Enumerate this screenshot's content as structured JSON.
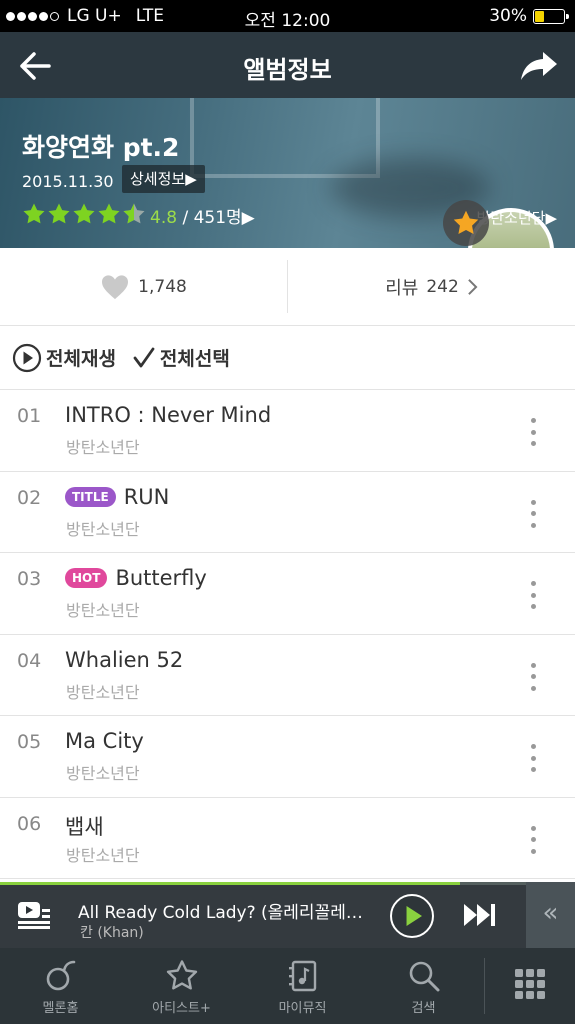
{
  "status_bar": {
    "carrier": "LG U+",
    "network": "LTE",
    "time": "오전 12:00",
    "battery": "30%",
    "battery_level": 0.3
  },
  "nav": {
    "title": "앨범정보",
    "back_icon": "back-arrow-icon",
    "share_icon": "share-arrow-icon"
  },
  "album": {
    "title": "화양연화 pt.2",
    "release_date": "2015.11.30",
    "detail_button": "상세정보▶",
    "rating_stars": 4.5,
    "rating_score": "4.8",
    "rating_count": "/ 451명▶",
    "artist": "방탄소년단▶",
    "colors": {
      "star": "#7ed321",
      "fav_star": "#f5a623"
    }
  },
  "stats": {
    "likes": "1,748",
    "review_label": "리뷰",
    "review_count": "242"
  },
  "toolbar": {
    "play_all": "전체재생",
    "select_all": "전체선택"
  },
  "tracks": [
    {
      "number": "01",
      "title": "INTRO : Never Mind",
      "artist": "방탄소년단",
      "badge": ""
    },
    {
      "number": "02",
      "title": "RUN",
      "artist": "방탄소년단",
      "badge": "TITLE"
    },
    {
      "number": "03",
      "title": "Butterfly",
      "artist": "방탄소년단",
      "badge": "HOT"
    },
    {
      "number": "04",
      "title": "Whalien 52",
      "artist": "방탄소년단",
      "badge": ""
    },
    {
      "number": "05",
      "title": "Ma City",
      "artist": "방탄소년단",
      "badge": ""
    },
    {
      "number": "06",
      "title": "뱁새",
      "artist": "방탄소년단",
      "badge": ""
    }
  ],
  "player": {
    "song": "All Ready Cold Lady? (올레리꼴레…",
    "artist": "칸 (Khan)",
    "progress": 0.8,
    "accent": "#8ad13f"
  },
  "tabs": [
    {
      "label": "멜론홈",
      "icon": "melon-home-icon"
    },
    {
      "label": "아티스트+",
      "icon": "star-outline-icon"
    },
    {
      "label": "마이뮤직",
      "icon": "my-music-icon"
    },
    {
      "label": "검색",
      "icon": "search-icon"
    },
    {
      "label": "",
      "icon": "grid-menu-icon"
    }
  ]
}
